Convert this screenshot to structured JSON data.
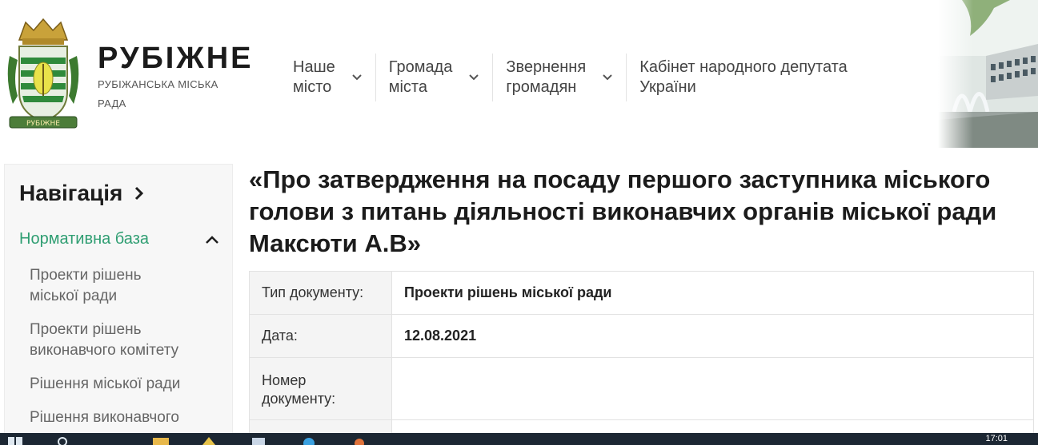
{
  "brand": {
    "title": "РУБІЖНЕ",
    "subtitle": "РУБІЖАНСЬКА МІСЬКА РАДА"
  },
  "nav": [
    {
      "label": "Наше\nмісто"
    },
    {
      "label": "Громада\nміста"
    },
    {
      "label": "Звернення\nгромадян"
    },
    {
      "label": "Кабінет народного депутата\nУкраїни"
    }
  ],
  "sidebar": {
    "title": "Навігація",
    "section": "Нормативна база",
    "items": [
      {
        "label": "Проекти рішень\nміської ради"
      },
      {
        "label": "Проекти рішень\nвиконавчого комітету"
      },
      {
        "label": "Рішення міської ради"
      },
      {
        "label": "Рішення виконавчого"
      }
    ]
  },
  "document": {
    "title": "«Про затвердження на посаду першого заступника міського голови з питань діяльності виконавчих органів міської ради Максюти А.В»",
    "rows": [
      {
        "key": "Тип документу:",
        "value": "Проекти рішень міської ради"
      },
      {
        "key": "Дата:",
        "value": "12.08.2021"
      },
      {
        "key": "Номер документу:",
        "value": ""
      }
    ]
  },
  "taskbar": {
    "clock": "17:01"
  },
  "colors": {
    "accent_green": "#2f9e72",
    "taskbar": "#1c2733"
  }
}
